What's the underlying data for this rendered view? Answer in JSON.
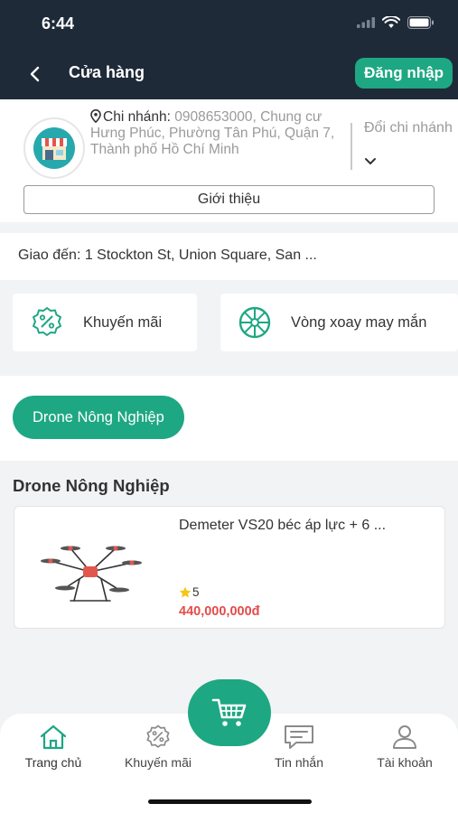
{
  "status_bar": {
    "time": "6:44"
  },
  "header": {
    "title": "Cửa hàng",
    "login_label": "Đăng nhập"
  },
  "branch": {
    "label": "Chi nhánh:",
    "details": "0908653000, Chung cư Hưng Phúc, Phường Tân Phú, Quận 7, Thành phố Hồ Chí Minh",
    "change_label": "Đổi chi nhánh",
    "intro_label": "Giới thiệu"
  },
  "delivery": {
    "text": "Giao đến: 1 Stockton St, Union Square, San ..."
  },
  "promos": [
    {
      "label": "Khuyến mãi",
      "icon": "discount-badge-icon"
    },
    {
      "label": "Vòng xoay may mắn",
      "icon": "lucky-wheel-icon"
    }
  ],
  "category_chip": {
    "label": "Drone Nông Nghiệp"
  },
  "section": {
    "title": "Drone Nông Nghiệp"
  },
  "product": {
    "name": "Demeter VS20 béc áp lực + 6 ...",
    "rating": "5",
    "price": "440,000,000đ"
  },
  "bottom_nav": {
    "items": [
      {
        "label": "Trang chủ",
        "icon": "home-icon"
      },
      {
        "label": "Khuyến mãi",
        "icon": "discount-badge-icon"
      },
      {
        "label": "Tin nhắn",
        "icon": "message-icon"
      },
      {
        "label": "Tài khoản",
        "icon": "account-icon"
      }
    ],
    "fab_icon": "cart-icon"
  },
  "colors": {
    "accent": "#1ea783",
    "header": "#1f2a38",
    "price": "#e54b4b"
  }
}
